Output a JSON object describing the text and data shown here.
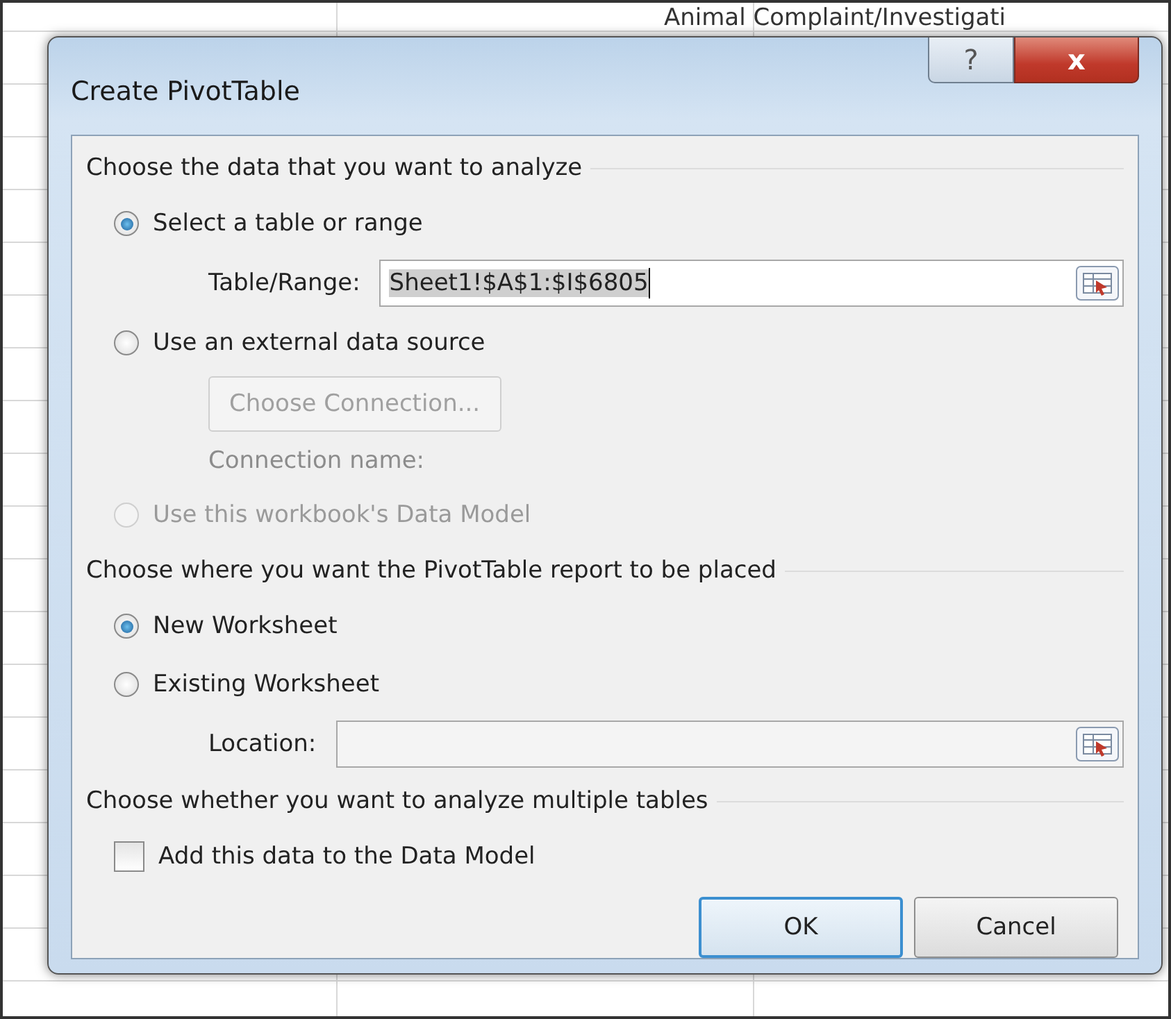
{
  "background_sheet": {
    "cell_text": "Animal Complaint/Investigati"
  },
  "window": {
    "title": "Create PivotTable",
    "help_button": "?",
    "close_button": "x"
  },
  "data_section": {
    "heading": "Choose the data that you want to analyze",
    "options": [
      {
        "label": "Select a table or range",
        "selected": true,
        "disabled": false
      },
      {
        "label": "Use an external data source",
        "selected": false,
        "disabled": false
      },
      {
        "label": "Use this workbook's Data Model",
        "selected": false,
        "disabled": true
      }
    ],
    "table_range": {
      "label": "Table/Range:",
      "value": "Sheet1!$A$1:$I$6805"
    },
    "choose_connection": {
      "label": "Choose Connection...",
      "disabled": true
    },
    "connection_name": {
      "label": "Connection name:",
      "disabled": true
    }
  },
  "placement_section": {
    "heading": "Choose where you want the PivotTable report to be placed",
    "options": [
      {
        "label": "New Worksheet",
        "selected": true,
        "disabled": false
      },
      {
        "label": "Existing Worksheet",
        "selected": false,
        "disabled": false
      }
    ],
    "location": {
      "label": "Location:"
    }
  },
  "tables_section": {
    "heading": "Choose whether you want to analyze multiple tables",
    "checkbox": {
      "label": "Add this data to the Data Model",
      "checked": false
    }
  },
  "buttons": [
    {
      "label": "OK",
      "default": true
    },
    {
      "label": "Cancel",
      "default": false
    }
  ]
}
